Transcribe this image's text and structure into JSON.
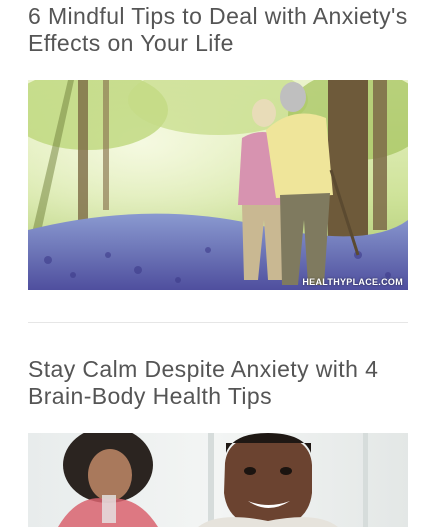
{
  "articles": [
    {
      "title": "6 Mindful Tips to Deal with Anxiety's Effects on Your Life",
      "image_watermark": "HEALTHYPLACE.COM"
    },
    {
      "title": "Stay Calm Despite Anxiety with 4 Brain-Body Health Tips"
    }
  ],
  "colors": {
    "title_text": "#555555",
    "divider": "#e6e6e6"
  }
}
